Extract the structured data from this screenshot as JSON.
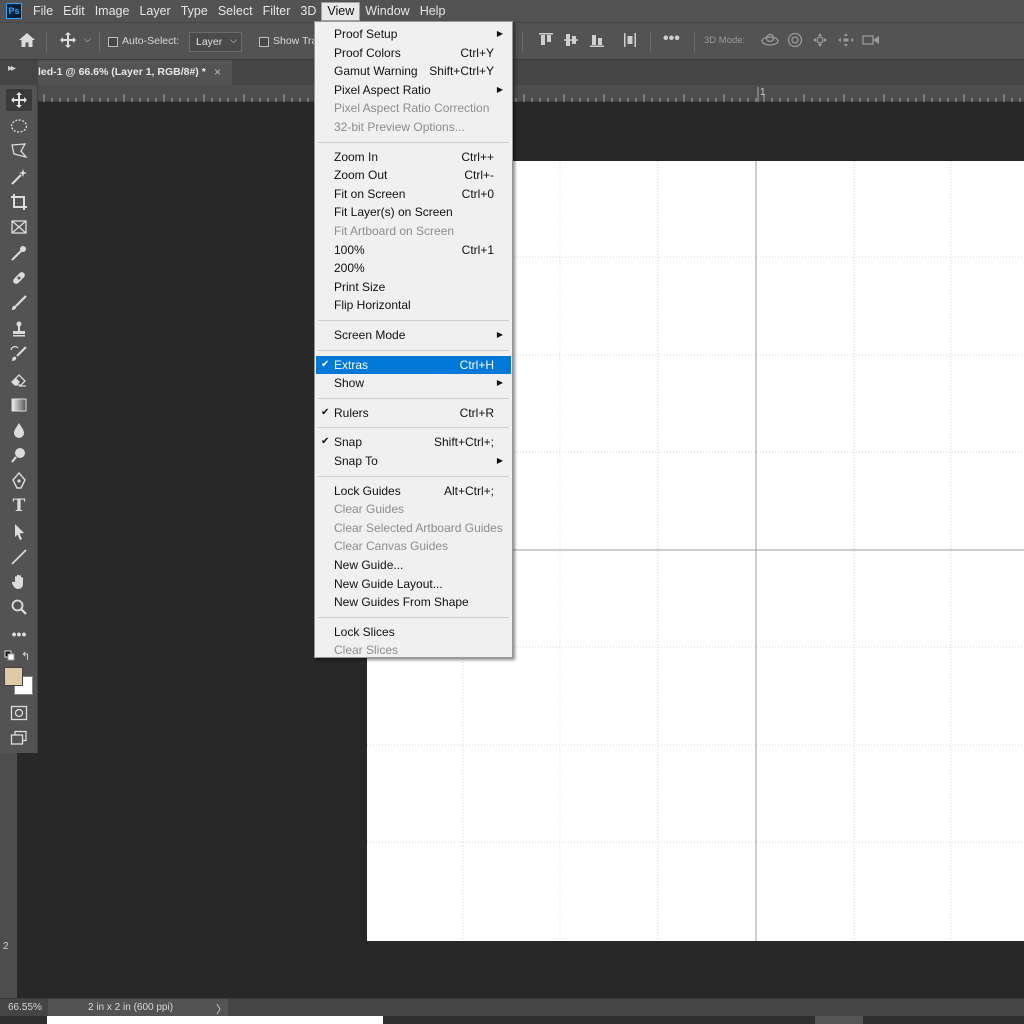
{
  "menubar": {
    "logo": "Ps",
    "items": [
      "File",
      "Edit",
      "Image",
      "Layer",
      "Type",
      "Select",
      "Filter",
      "3D",
      "View",
      "Window",
      "Help"
    ],
    "active": "View"
  },
  "options_bar": {
    "auto_select_label": "Auto-Select:",
    "layer_select_value": "Layer",
    "show_transform_label": "Show Tra",
    "mode_3d_label": "3D Mode:"
  },
  "document_tab": {
    "title": "led-1 @ 66.6% (Layer 1, RGB/8#) *",
    "close": "×"
  },
  "ruler": {
    "h_label": "1",
    "v_label": "2"
  },
  "status_bar": {
    "zoom": "66.55%",
    "doc_info": "2 in x 2 in (600 ppi)",
    "arrow": "〉"
  },
  "view_menu": {
    "groups": [
      [
        {
          "label": "Proof Setup",
          "shortcut": "",
          "submenu": true,
          "disabled": false
        },
        {
          "label": "Proof Colors",
          "shortcut": "Ctrl+Y",
          "submenu": false,
          "disabled": false
        },
        {
          "label": "Gamut Warning",
          "shortcut": "Shift+Ctrl+Y",
          "submenu": false,
          "disabled": false
        },
        {
          "label": "Pixel Aspect Ratio",
          "shortcut": "",
          "submenu": true,
          "disabled": false
        },
        {
          "label": "Pixel Aspect Ratio Correction",
          "shortcut": "",
          "submenu": false,
          "disabled": true
        },
        {
          "label": "32-bit Preview Options...",
          "shortcut": "",
          "submenu": false,
          "disabled": true
        }
      ],
      [
        {
          "label": "Zoom In",
          "shortcut": "Ctrl++",
          "submenu": false,
          "disabled": false
        },
        {
          "label": "Zoom Out",
          "shortcut": "Ctrl+-",
          "submenu": false,
          "disabled": false
        },
        {
          "label": "Fit on Screen",
          "shortcut": "Ctrl+0",
          "submenu": false,
          "disabled": false
        },
        {
          "label": "Fit Layer(s) on Screen",
          "shortcut": "",
          "submenu": false,
          "disabled": false
        },
        {
          "label": "Fit Artboard on Screen",
          "shortcut": "",
          "submenu": false,
          "disabled": true
        },
        {
          "label": "100%",
          "shortcut": "Ctrl+1",
          "submenu": false,
          "disabled": false
        },
        {
          "label": "200%",
          "shortcut": "",
          "submenu": false,
          "disabled": false
        },
        {
          "label": "Print Size",
          "shortcut": "",
          "submenu": false,
          "disabled": false
        },
        {
          "label": "Flip Horizontal",
          "shortcut": "",
          "submenu": false,
          "disabled": false
        }
      ],
      [
        {
          "label": "Screen Mode",
          "shortcut": "",
          "submenu": true,
          "disabled": false
        }
      ],
      [
        {
          "label": "Extras",
          "shortcut": "Ctrl+H",
          "submenu": false,
          "disabled": false,
          "checked": true,
          "highlighted": true
        },
        {
          "label": "Show",
          "shortcut": "",
          "submenu": true,
          "disabled": false
        }
      ],
      [
        {
          "label": "Rulers",
          "shortcut": "Ctrl+R",
          "submenu": false,
          "disabled": false,
          "checked": true
        }
      ],
      [
        {
          "label": "Snap",
          "shortcut": "Shift+Ctrl+;",
          "submenu": false,
          "disabled": false,
          "checked": true
        },
        {
          "label": "Snap To",
          "shortcut": "",
          "submenu": true,
          "disabled": false
        }
      ],
      [
        {
          "label": "Lock Guides",
          "shortcut": "Alt+Ctrl+;",
          "submenu": false,
          "disabled": false
        },
        {
          "label": "Clear Guides",
          "shortcut": "",
          "submenu": false,
          "disabled": true
        },
        {
          "label": "Clear Selected Artboard Guides",
          "shortcut": "",
          "submenu": false,
          "disabled": true
        },
        {
          "label": "Clear Canvas Guides",
          "shortcut": "",
          "submenu": false,
          "disabled": true
        },
        {
          "label": "New Guide...",
          "shortcut": "",
          "submenu": false,
          "disabled": false
        },
        {
          "label": "New Guide Layout...",
          "shortcut": "",
          "submenu": false,
          "disabled": false
        },
        {
          "label": "New Guides From Shape",
          "shortcut": "",
          "submenu": false,
          "disabled": false
        }
      ],
      [
        {
          "label": "Lock Slices",
          "shortcut": "",
          "submenu": false,
          "disabled": false
        },
        {
          "label": "Clear Slices",
          "shortcut": "",
          "submenu": false,
          "disabled": true
        }
      ]
    ]
  },
  "colors": {
    "foreground_swatch": "#e0c9a6",
    "background_swatch": "#ffffff",
    "highlight": "#0078d7"
  }
}
